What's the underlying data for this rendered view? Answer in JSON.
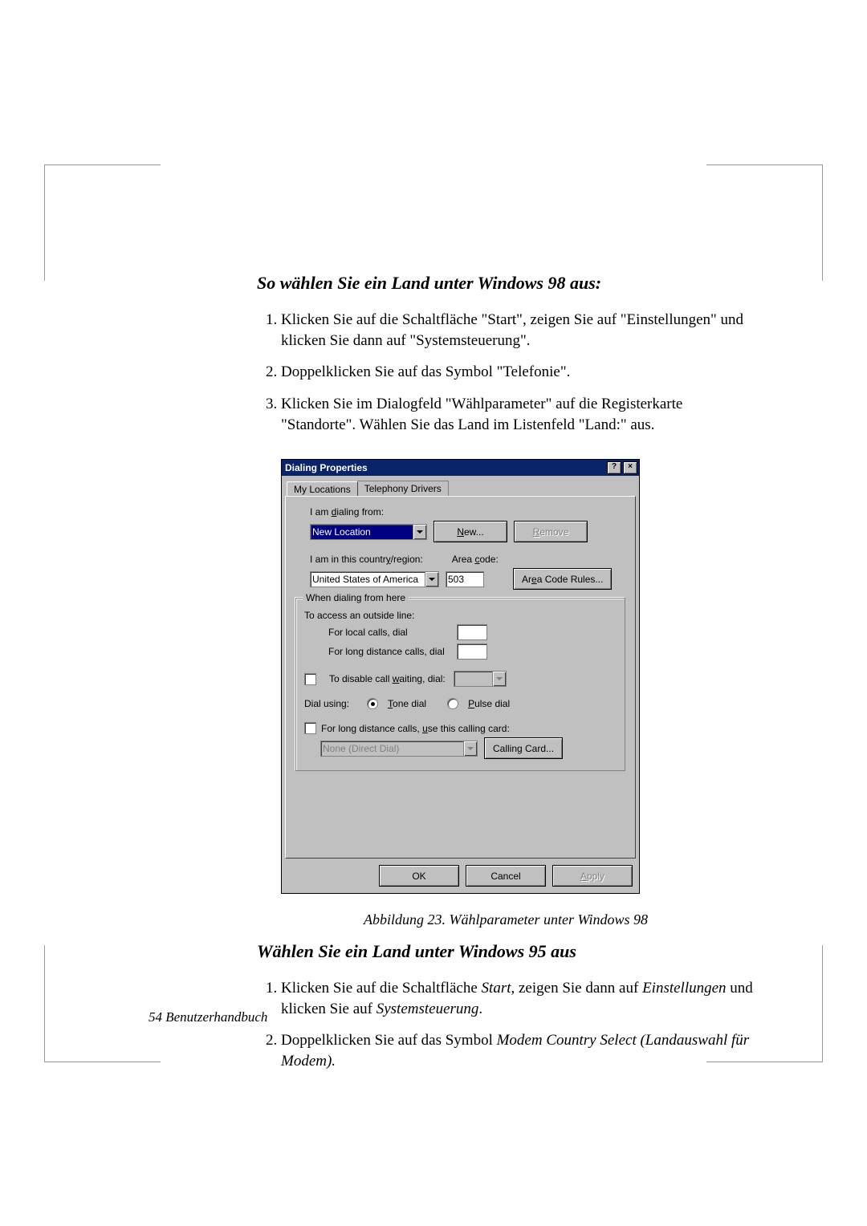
{
  "heading1": "So wählen Sie ein Land unter Windows 98 aus:",
  "steps1": [
    "Klicken Sie auf die Schaltfläche \"Start\", zeigen Sie auf \"Einstellungen\" und klicken Sie dann auf \"Systemsteuerung\".",
    "Doppelklicken Sie auf das Symbol \"Telefonie\".",
    "Klicken Sie im Dialogfeld \"Wählparameter\" auf die Registerkarte \"Standorte\". Wählen Sie das Land im Listenfeld \"Land:\" aus."
  ],
  "caption": "Abbildung 23.   Wählparameter unter Windows 98",
  "heading2": "Wählen Sie ein Land unter Windows 95 aus",
  "steps2_1_pre": "Klicken Sie auf die Schaltfläche ",
  "steps2_1_i1": "Start",
  "steps2_1_mid": ", zeigen Sie dann auf ",
  "steps2_1_i2": "Einstellungen",
  "steps2_1_mid2": " und klicken Sie auf ",
  "steps2_1_i3": "Systemsteuerung",
  "steps2_1_end": ".",
  "steps2_2_pre": "Doppelklicken Sie auf das Symbol ",
  "steps2_2_i1": "Modem Country Select (Landauswahl für Modem).",
  "footer": "54  Benutzerhandbuch",
  "dlg": {
    "title": "Dialing Properties",
    "tab1": "My Locations",
    "tab2": "Telephony Drivers",
    "l_dialing_from_pre": "I am ",
    "l_dialing_from_u": "d",
    "l_dialing_from_post": "ialing from:",
    "location": "New Location",
    "new_u": "N",
    "new_post": "ew...",
    "remove_u": "R",
    "remove_post": "emove",
    "l_country_pre": "I am in this countr",
    "l_country_u": "y",
    "l_country_post": "/region:",
    "l_areacode_pre": "Area ",
    "l_areacode_u": "c",
    "l_areacode_post": "ode:",
    "country": "United States of America",
    "areacode": "503",
    "areacoderules_pre": "Ar",
    "areacoderules_u": "e",
    "areacoderules_post": "a Code Rules...",
    "group_title": "When dialing from here",
    "outside_line": "To access an outside line:",
    "local_calls": "For local calls, dial",
    "long_calls": "For long distance calls, dial",
    "disable_pre": "To disable call ",
    "disable_u": "w",
    "disable_post": "aiting, dial:",
    "dial_using": "Dial using:",
    "tone_u": "T",
    "tone_post": "one dial",
    "pulse_u": "P",
    "pulse_post": "ulse dial",
    "calling_card_chk_pre": "For long distance calls, ",
    "calling_card_chk_u": "u",
    "calling_card_chk_post": "se this calling card:",
    "calling_card_val": "None (Direct Dial)",
    "calling_card_btn": "Calling Card...",
    "ok": "OK",
    "cancel": "Cancel",
    "apply_u": "A",
    "apply_post": "pply"
  }
}
